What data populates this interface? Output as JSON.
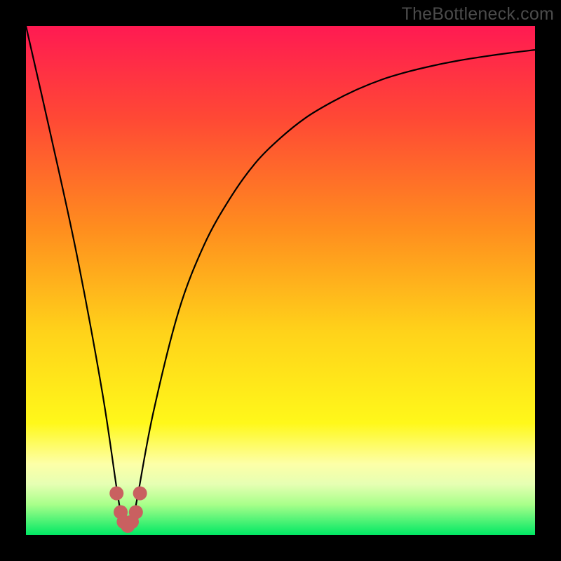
{
  "watermark": "TheBottleneck.com",
  "chart_data": {
    "type": "line",
    "title": "",
    "xlabel": "",
    "ylabel": "",
    "xlim": [
      0,
      100
    ],
    "ylim": [
      0,
      100
    ],
    "grid": false,
    "series": [
      {
        "name": "curve",
        "color": "#000000",
        "x": [
          0,
          5,
          10,
          15,
          18,
          19,
          20,
          21,
          22,
          25,
          30,
          35,
          40,
          45,
          50,
          55,
          60,
          65,
          70,
          75,
          80,
          85,
          90,
          95,
          100
        ],
        "values": [
          100,
          78,
          55,
          28,
          8,
          3,
          1,
          3,
          8,
          24,
          44,
          57,
          66,
          73,
          78,
          82,
          85,
          87.5,
          89.5,
          91,
          92.2,
          93.2,
          94,
          94.7,
          95.3
        ]
      },
      {
        "name": "marker-cluster",
        "color": "#c96060",
        "marker_size": 10,
        "x": [
          17.8,
          18.6,
          19.2,
          20.0,
          20.8,
          21.6,
          22.4
        ],
        "values": [
          8.2,
          4.5,
          2.6,
          1.8,
          2.6,
          4.5,
          8.2
        ]
      }
    ],
    "background_gradient": {
      "stops": [
        {
          "offset": 0.0,
          "color": "#ff1a52"
        },
        {
          "offset": 0.18,
          "color": "#ff4835"
        },
        {
          "offset": 0.4,
          "color": "#ff8e1e"
        },
        {
          "offset": 0.6,
          "color": "#ffd21a"
        },
        {
          "offset": 0.78,
          "color": "#fff81a"
        },
        {
          "offset": 0.86,
          "color": "#fdffa7"
        },
        {
          "offset": 0.9,
          "color": "#e6ffb3"
        },
        {
          "offset": 0.94,
          "color": "#a8ff8a"
        },
        {
          "offset": 1.0,
          "color": "#00e864"
        }
      ]
    }
  }
}
